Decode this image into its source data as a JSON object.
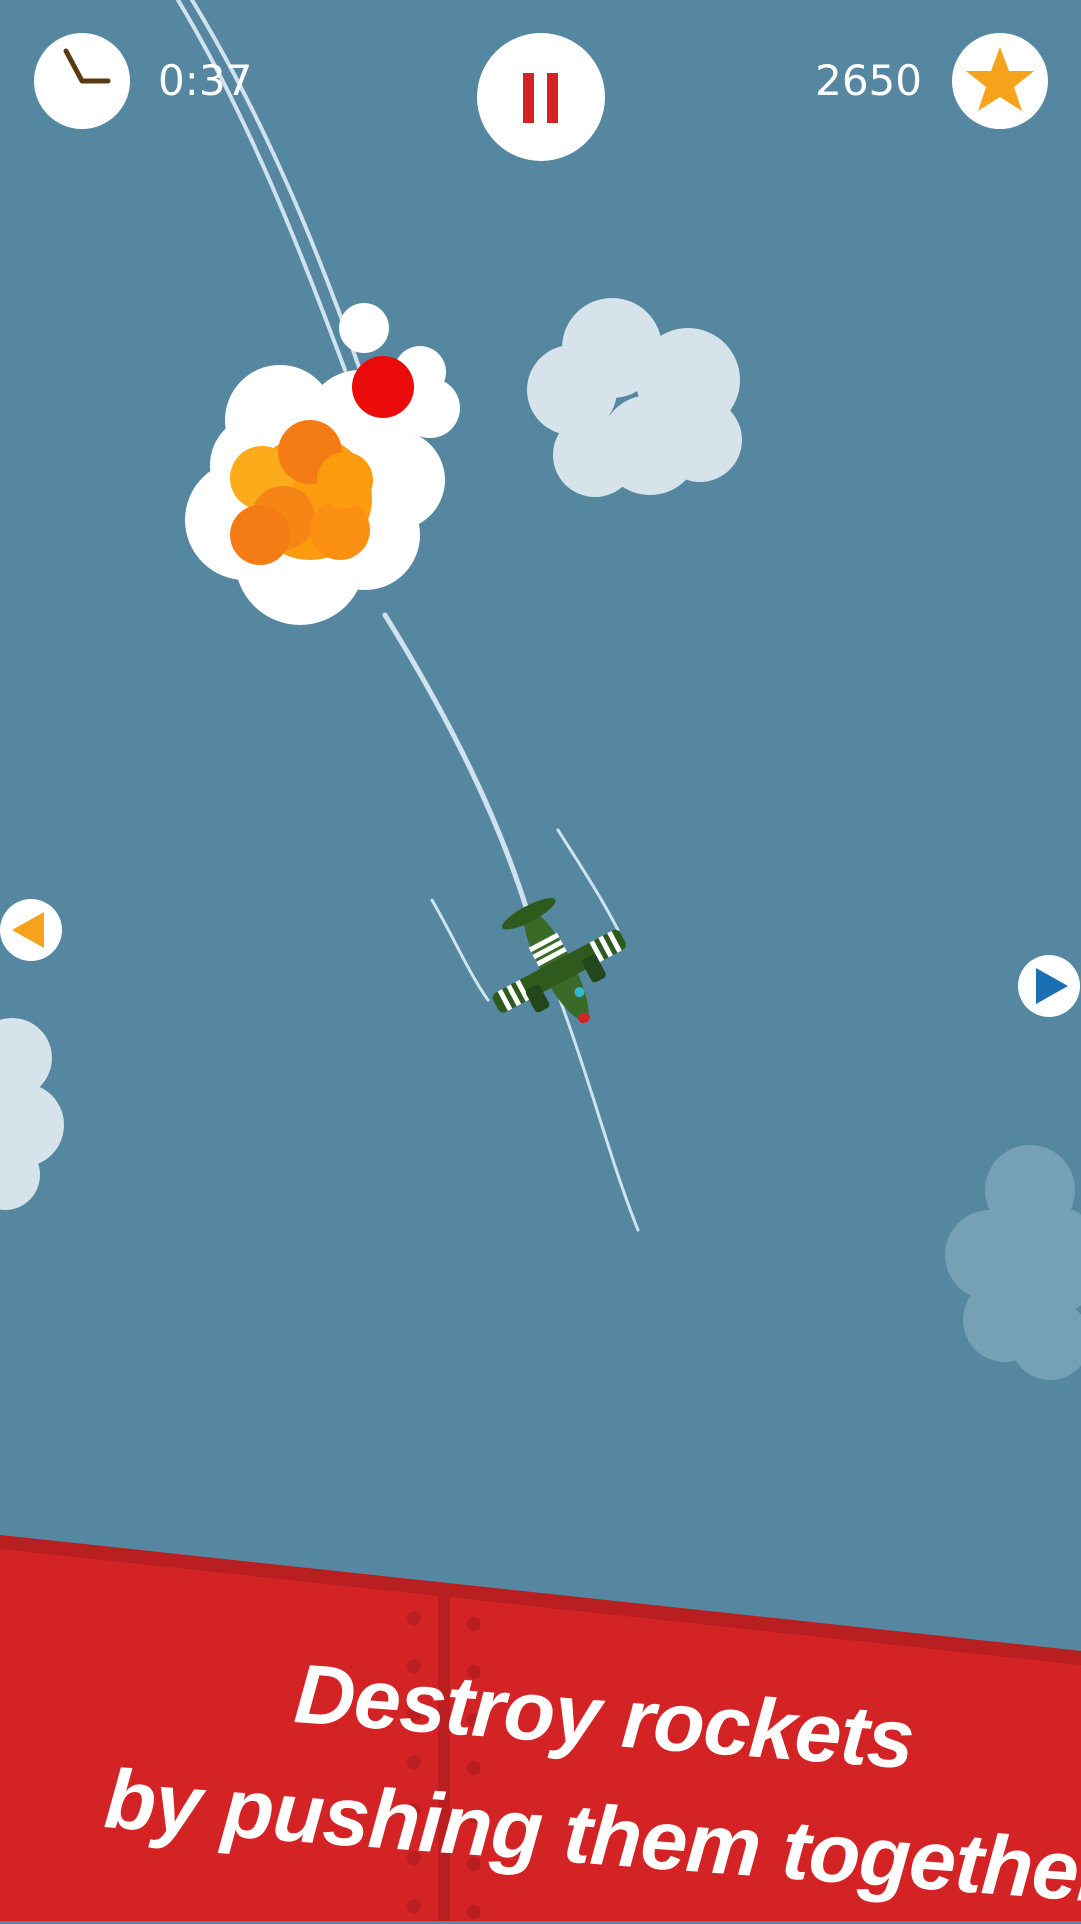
{
  "hud": {
    "timer": "0:37",
    "score": "2650",
    "timer_icon": "clock-icon",
    "pause_icon": "pause-icon",
    "score_icon": "star-icon"
  },
  "controls": {
    "left_icon": "left-arrow-icon",
    "right_icon": "right-arrow-icon"
  },
  "banner": {
    "line1": "Destroy rockets",
    "line2": "by pushing them together!"
  },
  "colors": {
    "sky": "#5687a1",
    "banner_red": "#d42325",
    "pause_red": "#d42325",
    "star": "#f5a31a",
    "left_arrow": "#f5a31a",
    "right_arrow": "#1b6fb3",
    "plane_green": "#3a6b26"
  }
}
